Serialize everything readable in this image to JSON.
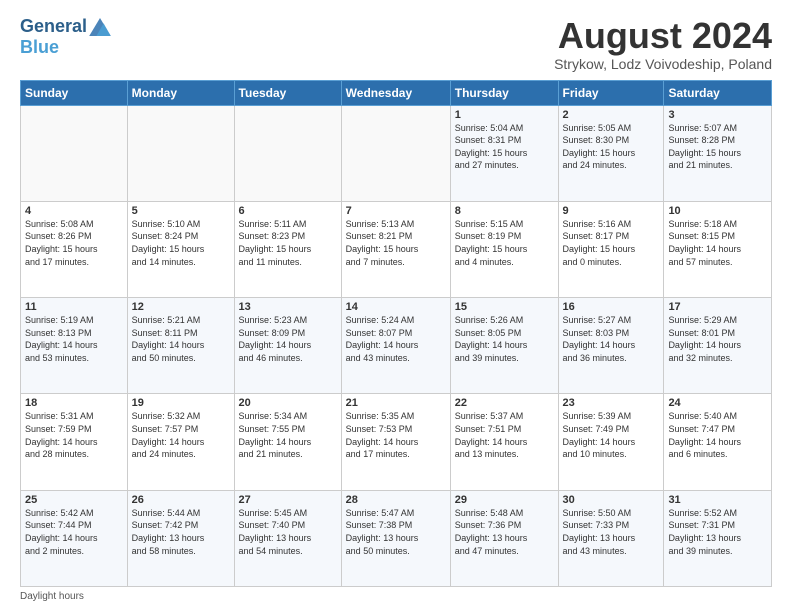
{
  "logo": {
    "general": "General",
    "blue": "Blue"
  },
  "header": {
    "month_title": "August 2024",
    "subtitle": "Strykow, Lodz Voivodeship, Poland"
  },
  "days_of_week": [
    "Sunday",
    "Monday",
    "Tuesday",
    "Wednesday",
    "Thursday",
    "Friday",
    "Saturday"
  ],
  "footer": {
    "daylight_note": "Daylight hours"
  },
  "weeks": [
    [
      {
        "day": "",
        "info": ""
      },
      {
        "day": "",
        "info": ""
      },
      {
        "day": "",
        "info": ""
      },
      {
        "day": "",
        "info": ""
      },
      {
        "day": "1",
        "info": "Sunrise: 5:04 AM\nSunset: 8:31 PM\nDaylight: 15 hours\nand 27 minutes."
      },
      {
        "day": "2",
        "info": "Sunrise: 5:05 AM\nSunset: 8:30 PM\nDaylight: 15 hours\nand 24 minutes."
      },
      {
        "day": "3",
        "info": "Sunrise: 5:07 AM\nSunset: 8:28 PM\nDaylight: 15 hours\nand 21 minutes."
      }
    ],
    [
      {
        "day": "4",
        "info": "Sunrise: 5:08 AM\nSunset: 8:26 PM\nDaylight: 15 hours\nand 17 minutes."
      },
      {
        "day": "5",
        "info": "Sunrise: 5:10 AM\nSunset: 8:24 PM\nDaylight: 15 hours\nand 14 minutes."
      },
      {
        "day": "6",
        "info": "Sunrise: 5:11 AM\nSunset: 8:23 PM\nDaylight: 15 hours\nand 11 minutes."
      },
      {
        "day": "7",
        "info": "Sunrise: 5:13 AM\nSunset: 8:21 PM\nDaylight: 15 hours\nand 7 minutes."
      },
      {
        "day": "8",
        "info": "Sunrise: 5:15 AM\nSunset: 8:19 PM\nDaylight: 15 hours\nand 4 minutes."
      },
      {
        "day": "9",
        "info": "Sunrise: 5:16 AM\nSunset: 8:17 PM\nDaylight: 15 hours\nand 0 minutes."
      },
      {
        "day": "10",
        "info": "Sunrise: 5:18 AM\nSunset: 8:15 PM\nDaylight: 14 hours\nand 57 minutes."
      }
    ],
    [
      {
        "day": "11",
        "info": "Sunrise: 5:19 AM\nSunset: 8:13 PM\nDaylight: 14 hours\nand 53 minutes."
      },
      {
        "day": "12",
        "info": "Sunrise: 5:21 AM\nSunset: 8:11 PM\nDaylight: 14 hours\nand 50 minutes."
      },
      {
        "day": "13",
        "info": "Sunrise: 5:23 AM\nSunset: 8:09 PM\nDaylight: 14 hours\nand 46 minutes."
      },
      {
        "day": "14",
        "info": "Sunrise: 5:24 AM\nSunset: 8:07 PM\nDaylight: 14 hours\nand 43 minutes."
      },
      {
        "day": "15",
        "info": "Sunrise: 5:26 AM\nSunset: 8:05 PM\nDaylight: 14 hours\nand 39 minutes."
      },
      {
        "day": "16",
        "info": "Sunrise: 5:27 AM\nSunset: 8:03 PM\nDaylight: 14 hours\nand 36 minutes."
      },
      {
        "day": "17",
        "info": "Sunrise: 5:29 AM\nSunset: 8:01 PM\nDaylight: 14 hours\nand 32 minutes."
      }
    ],
    [
      {
        "day": "18",
        "info": "Sunrise: 5:31 AM\nSunset: 7:59 PM\nDaylight: 14 hours\nand 28 minutes."
      },
      {
        "day": "19",
        "info": "Sunrise: 5:32 AM\nSunset: 7:57 PM\nDaylight: 14 hours\nand 24 minutes."
      },
      {
        "day": "20",
        "info": "Sunrise: 5:34 AM\nSunset: 7:55 PM\nDaylight: 14 hours\nand 21 minutes."
      },
      {
        "day": "21",
        "info": "Sunrise: 5:35 AM\nSunset: 7:53 PM\nDaylight: 14 hours\nand 17 minutes."
      },
      {
        "day": "22",
        "info": "Sunrise: 5:37 AM\nSunset: 7:51 PM\nDaylight: 14 hours\nand 13 minutes."
      },
      {
        "day": "23",
        "info": "Sunrise: 5:39 AM\nSunset: 7:49 PM\nDaylight: 14 hours\nand 10 minutes."
      },
      {
        "day": "24",
        "info": "Sunrise: 5:40 AM\nSunset: 7:47 PM\nDaylight: 14 hours\nand 6 minutes."
      }
    ],
    [
      {
        "day": "25",
        "info": "Sunrise: 5:42 AM\nSunset: 7:44 PM\nDaylight: 14 hours\nand 2 minutes."
      },
      {
        "day": "26",
        "info": "Sunrise: 5:44 AM\nSunset: 7:42 PM\nDaylight: 13 hours\nand 58 minutes."
      },
      {
        "day": "27",
        "info": "Sunrise: 5:45 AM\nSunset: 7:40 PM\nDaylight: 13 hours\nand 54 minutes."
      },
      {
        "day": "28",
        "info": "Sunrise: 5:47 AM\nSunset: 7:38 PM\nDaylight: 13 hours\nand 50 minutes."
      },
      {
        "day": "29",
        "info": "Sunrise: 5:48 AM\nSunset: 7:36 PM\nDaylight: 13 hours\nand 47 minutes."
      },
      {
        "day": "30",
        "info": "Sunrise: 5:50 AM\nSunset: 7:33 PM\nDaylight: 13 hours\nand 43 minutes."
      },
      {
        "day": "31",
        "info": "Sunrise: 5:52 AM\nSunset: 7:31 PM\nDaylight: 13 hours\nand 39 minutes."
      }
    ]
  ]
}
